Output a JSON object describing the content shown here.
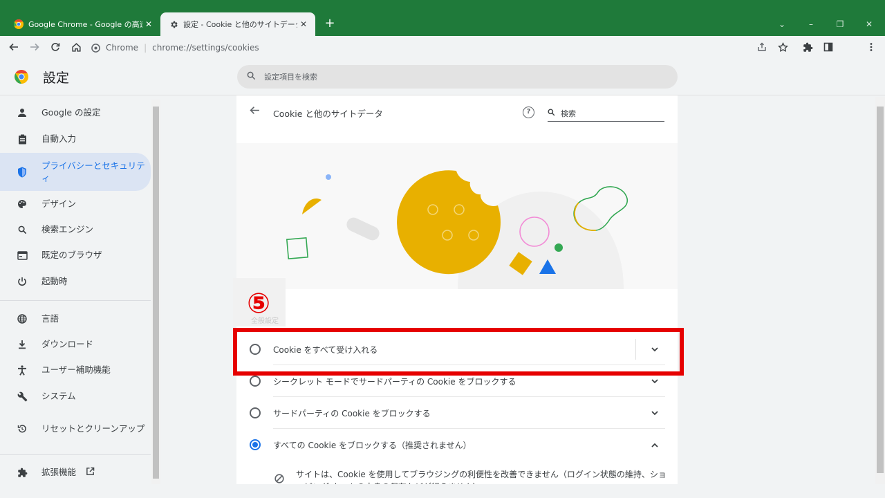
{
  "tabs": [
    {
      "title": "Google Chrome - Google の高速",
      "close": "✕",
      "active": false
    },
    {
      "title": "設定 - Cookie と他のサイトデータ",
      "close": "✕",
      "active": true
    }
  ],
  "new_tab": "+",
  "window_controls": {
    "dropdown": "⌄",
    "minimize": "–",
    "restore": "❐",
    "close": "✕"
  },
  "toolbar": {
    "site_chip": "Chrome",
    "url": "chrome://settings/cookies"
  },
  "app": {
    "title": "設定",
    "search_placeholder": "設定項目を検索"
  },
  "sidebar": {
    "items": [
      {
        "label": "Google の設定",
        "icon": "person-icon"
      },
      {
        "label": "自動入力",
        "icon": "clipboard-icon"
      },
      {
        "label": "プライバシーとセキュリティ",
        "icon": "shield-icon",
        "active": true
      },
      {
        "label": "デザイン",
        "icon": "palette-icon"
      },
      {
        "label": "検索エンジン",
        "icon": "search-icon"
      },
      {
        "label": "既定のブラウザ",
        "icon": "browser-icon"
      },
      {
        "label": "起動時",
        "icon": "power-icon"
      },
      {
        "label": "言語",
        "icon": "globe-icon"
      },
      {
        "label": "ダウンロード",
        "icon": "download-icon"
      },
      {
        "label": "ユーザー補助機能",
        "icon": "accessibility-icon"
      },
      {
        "label": "システム",
        "icon": "wrench-icon"
      },
      {
        "label": "リセットとクリーンアップ",
        "icon": "restore-icon"
      },
      {
        "label": "拡張機能",
        "icon": "puzzle-icon"
      }
    ]
  },
  "page": {
    "title": "Cookie と他のサイトデータ",
    "search_label": "検索",
    "step_marker": "⑤",
    "section_label": "全般設定"
  },
  "options": [
    {
      "label": "Cookie をすべて受け入れる",
      "checked": false,
      "expanded": false
    },
    {
      "label": "シークレット モードでサードパーティの Cookie をブロックする",
      "checked": false,
      "expanded": false
    },
    {
      "label": "サードパーティの Cookie をブロックする",
      "checked": false,
      "expanded": false
    },
    {
      "label": "すべての Cookie をブロックする（推奨されません）",
      "checked": true,
      "expanded": true
    }
  ],
  "description": "サイトは、Cookie を使用してブラウジングの利便性を改善できません（ログイン状態の維持、ショッピング カートの中身の保存などが行えません）",
  "colors": {
    "tab_strip": "#1f7a3a",
    "accent": "#1a73e8",
    "highlight": "#e60000"
  }
}
